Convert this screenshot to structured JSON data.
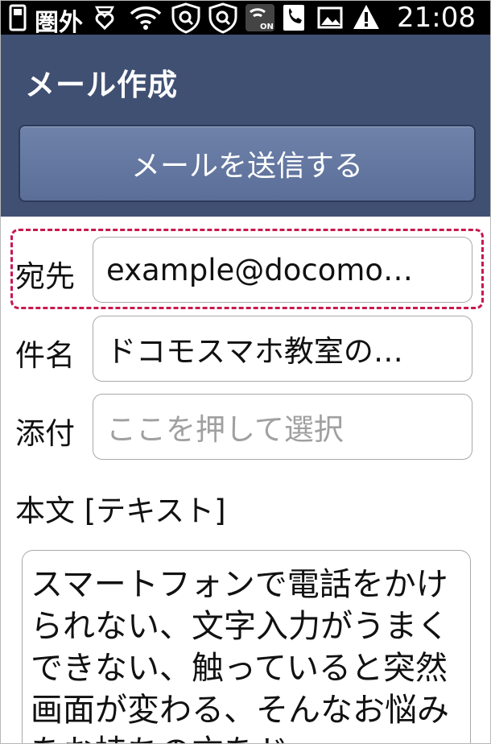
{
  "status_bar": {
    "carrier_text": "圏外",
    "time": "21:08"
  },
  "header": {
    "title": "メール作成",
    "send_button_label": "メールを送信する"
  },
  "form": {
    "to": {
      "label": "宛先",
      "value": "example@docomo…"
    },
    "subject": {
      "label": "件名",
      "value": "ドコモスマホ教室の…"
    },
    "attachment": {
      "label": "添付",
      "placeholder": "ここを押して選択"
    },
    "body": {
      "label": "本文 [テキスト]",
      "value": "スマートフォンで電話をかけられない、文字入力がうまくできない、触っていると突然画面が変わる、そんなお悩みをお持ちの方をド"
    }
  },
  "colors": {
    "header_bg": "#405073",
    "button_bg": "#6277a1",
    "highlight": "#c8184e"
  },
  "icons": [
    "sim-card-icon",
    "heart-notification-icon",
    "wifi-icon",
    "shield-search-icon",
    "shield-search-icon",
    "wifi-calling-on-icon",
    "phone-contact-icon",
    "image-icon",
    "warning-icon"
  ]
}
